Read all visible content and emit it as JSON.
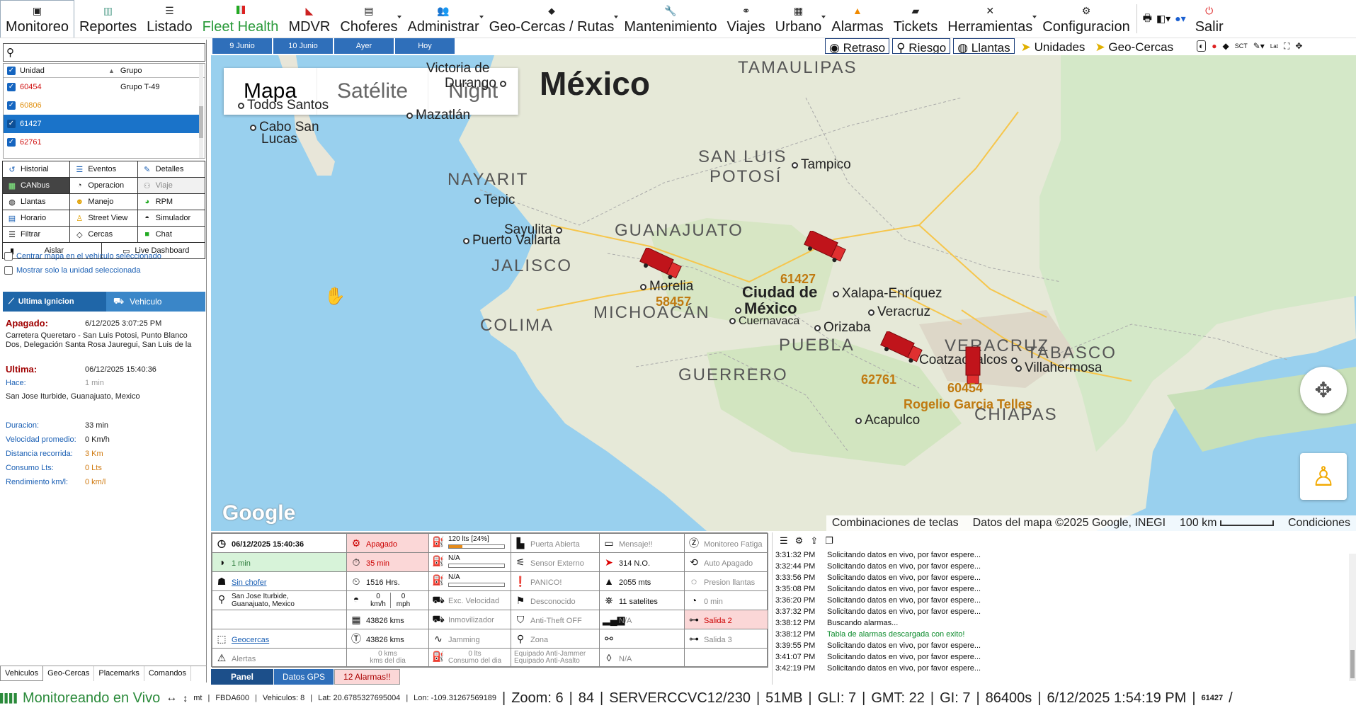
{
  "nav": {
    "items": [
      {
        "label": "Monitoreo",
        "icon": "monitor-icon"
      },
      {
        "label": "Reportes",
        "icon": "report-icon"
      },
      {
        "label": "Listado",
        "icon": "list-icon"
      },
      {
        "label": "Fleet Health",
        "icon": "flag-icon"
      },
      {
        "label": "MDVR",
        "icon": "camera-icon"
      },
      {
        "label": "Choferes",
        "icon": "id-card-icon"
      },
      {
        "label": "Administrar",
        "icon": "users-icon"
      },
      {
        "label": "Geo-Cercas / Rutas",
        "icon": "pin-icon"
      },
      {
        "label": "Mantenimiento",
        "icon": "wrench-icon"
      },
      {
        "label": "Viajes",
        "icon": "binoculars-icon"
      },
      {
        "label": "Urbano",
        "icon": "bus-icon"
      },
      {
        "label": "Alarmas",
        "icon": "warning-icon"
      },
      {
        "label": "Tickets",
        "icon": "ticket-icon"
      },
      {
        "label": "Herramientas",
        "icon": "tools-icon"
      },
      {
        "label": "Configuracion",
        "icon": "gear-icon"
      },
      {
        "label": "Salir",
        "icon": "power-icon"
      }
    ]
  },
  "units": {
    "col_unit": "Unidad",
    "col_group": "Grupo",
    "rows": [
      {
        "id": "60454",
        "group": "Grupo T-49",
        "color": "#d01010"
      },
      {
        "id": "60806",
        "group": "",
        "color": "#e09010"
      },
      {
        "id": "61427",
        "group": "",
        "color": "#ffffff"
      },
      {
        "id": "62761",
        "group": "",
        "color": "#d01010"
      }
    ]
  },
  "buttons": {
    "historial": "Historial",
    "eventos": "Eventos",
    "detalles": "Detalles",
    "canbus": "CANbus",
    "operacion": "Operacion",
    "viaje": "Viaje",
    "llantas": "Llantas",
    "manejo": "Manejo",
    "rpm": "RPM",
    "horario": "Horario",
    "streetview": "Street View",
    "simulador": "Simulador",
    "filtrar": "Filtrar",
    "cercas": "Cercas",
    "chat": "Chat",
    "aislar": "Aislar",
    "livedash": "Live Dashboard"
  },
  "options": {
    "center": "Centrar mapa en el vehiculo seleccionado",
    "only": "Mostrar solo la unidad seleccionada"
  },
  "ignition": {
    "tab1": "Ultima Ignicion",
    "tab2": "Vehiculo",
    "apagado_label": "Apagado:",
    "apagado_time": "6/12/2025 3:07:25 PM",
    "address1": "Carretera Queretaro - San Luis Potosi, Punto Blanco",
    "address2": "Dos, Delegación Santa Rosa Jauregui, San Luis de la",
    "ultima_label": "Ultima:",
    "ultima_time": "06/12/2025 15:40:36",
    "hace_label": "Hace:",
    "hace_val": "1 min",
    "location": "San Jose Iturbide, Guanajuato, Mexico",
    "duracion_label": "Duracion:",
    "duracion_val": "33 min",
    "vel_label": "Velocidad promedio:",
    "vel_val": "0 Km/h",
    "dist_label": "Distancia recorrida:",
    "dist_val": "3 Km",
    "cons_label": "Consumo Lts:",
    "cons_val": "0 Lts",
    "rend_label": "Rendimiento km/l:",
    "rend_val": "0 km/l"
  },
  "left_tabs": [
    "Vehiculos",
    "Geo-Cercas",
    "Placemarks",
    "Comandos"
  ],
  "date_tabs": [
    "9 Junio",
    "10 Junio",
    "Ayer",
    "Hoy"
  ],
  "layers": [
    "Retraso",
    "Riesgo",
    "Llantas",
    "Unidades",
    "Geo-Cercas"
  ],
  "map": {
    "types": [
      "Mapa",
      "Satélite",
      "Night"
    ],
    "country": "México",
    "states": [
      {
        "name": "TAMAULIPAS"
      },
      {
        "name": "SAN LUIS"
      },
      {
        "name": "POTOSÍ"
      },
      {
        "name": "NAYARIT"
      },
      {
        "name": "GUANAJUATO"
      },
      {
        "name": "JALISCO"
      },
      {
        "name": "MICHOACÁN"
      },
      {
        "name": "COLIMA"
      },
      {
        "name": "PUEBLA"
      },
      {
        "name": "VERACRUZ"
      },
      {
        "name": "TABASCO"
      },
      {
        "name": "GUERRERO"
      },
      {
        "name": "CHIAPAS"
      }
    ],
    "cities": [
      {
        "name": "Victoria de"
      },
      {
        "name": "Durango"
      },
      {
        "name": "Todos Santos"
      },
      {
        "name": "Cabo San"
      },
      {
        "name": "Lucas"
      },
      {
        "name": "Mazatlán"
      },
      {
        "name": "Tampico"
      },
      {
        "name": "Tepic"
      },
      {
        "name": "Sayulita"
      },
      {
        "name": "Puerto Vallarta"
      },
      {
        "name": "Morelia"
      },
      {
        "name": "Ciudad de"
      },
      {
        "name": "México"
      },
      {
        "name": "Cuernavaca"
      },
      {
        "name": "Xalapa-Enríquez"
      },
      {
        "name": "Veracruz"
      },
      {
        "name": "Orizaba"
      },
      {
        "name": "Coatzacoalcos"
      },
      {
        "name": "Villahermosa"
      },
      {
        "name": "Acapulco"
      }
    ],
    "vehicles": [
      {
        "label": "58457"
      },
      {
        "label": "61427"
      },
      {
        "label": "62761"
      },
      {
        "label": "60454"
      }
    ],
    "driver": "Rogelio Garcia Telles",
    "footer": {
      "keys": "Combinaciones de teclas",
      "data": "Datos del mapa ©2025 Google, INEGI",
      "scale": "100 km",
      "terms": "Condiciones"
    },
    "google": "Google"
  },
  "panel": {
    "datetime": "06/12/2025 15:40:36",
    "status": "Apagado",
    "fuel": "120 lts [24%]",
    "fuel_pct": 24,
    "door": "Puerta Abierta",
    "msg": "Mensaje!!",
    "fatigue": "Monitoreo Fatiga",
    "since": "1 min",
    "since2": "35 min",
    "na1": "N/A",
    "ext_sensor": "Sensor Externo",
    "heading": "314 N.O.",
    "auto_off": "Auto Apagado",
    "driver": "Sin chofer",
    "hours": "1516 Hrs.",
    "na2": "N/A",
    "panic": "PANICO!",
    "altitude": "2055 mts",
    "tire_press": "Presion llantas",
    "place": "San Jose Iturbide,",
    "place2": "Guanajuato, Mexico",
    "kmh_val": "0",
    "kmh": "km/h",
    "mph_val": "0",
    "mph": "mph",
    "exc_speed": "Exc. Velocidad",
    "unknown": "Desconocido",
    "satellites": "11 satelites",
    "idle": "0 min",
    "odo1": "43826 kms",
    "immob": "Inmovilizador",
    "antitheft": "Anti-Theft OFF",
    "na3": "N/A",
    "out2": "Salida 2",
    "geofences": "Geocercas",
    "odo2": "43826 kms",
    "jamming": "Jamming",
    "zone": "Zona",
    "out3": "Salida 3",
    "alerts": "Alertas",
    "kms_day": "0 kms",
    "kms_day2": "kms del dia",
    "lts_day": "0 lts",
    "lts_day2": "Consumo del dia",
    "antijam": "Equipado Anti-Jammer",
    "antiasalto": "Equipado Anti-Asalto",
    "na4": "N/A"
  },
  "panel_tabs": [
    "Panel",
    "Datos GPS",
    "12 Alarmas!!"
  ],
  "log": [
    {
      "t": "3:31:32 PM",
      "m": "Solicitando datos en vivo, por favor espere..."
    },
    {
      "t": "3:32:44 PM",
      "m": "Solicitando datos en vivo, por favor espere..."
    },
    {
      "t": "3:33:56 PM",
      "m": "Solicitando datos en vivo, por favor espere..."
    },
    {
      "t": "3:35:08 PM",
      "m": "Solicitando datos en vivo, por favor espere..."
    },
    {
      "t": "3:36:20 PM",
      "m": "Solicitando datos en vivo, por favor espere..."
    },
    {
      "t": "3:37:32 PM",
      "m": "Solicitando datos en vivo, por favor espere..."
    },
    {
      "t": "3:38:12 PM",
      "m": "Buscando alarmas..."
    },
    {
      "t": "3:38:12 PM",
      "m": "Tabla de alarmas descargada con exito!"
    },
    {
      "t": "3:39:55 PM",
      "m": "Solicitando datos en vivo, por favor espere..."
    },
    {
      "t": "3:41:07 PM",
      "m": "Solicitando datos en vivo, por favor espere..."
    },
    {
      "t": "3:42:19 PM",
      "m": "Solicitando datos en vivo, por favor espere..."
    }
  ],
  "status": {
    "live": "Monitoreando en Vivo",
    "mt": "mt",
    "fbda": "FBDA600",
    "vehicles": "Vehiculos: 8",
    "lat": "Lat: 20.6785327695004",
    "lon": "Lon: -109.31267569189",
    "zoom": "Zoom: 6",
    "n84": "84",
    "server": "SERVERCCVC12/230",
    "mem": "51MB",
    "gli": "GLI: 7",
    "gmt": "GMT: 22",
    "gi": "GI: 7",
    "secs": "86400s",
    "date": "6/12/2025 1:54:19 PM",
    "unit": "61427"
  }
}
